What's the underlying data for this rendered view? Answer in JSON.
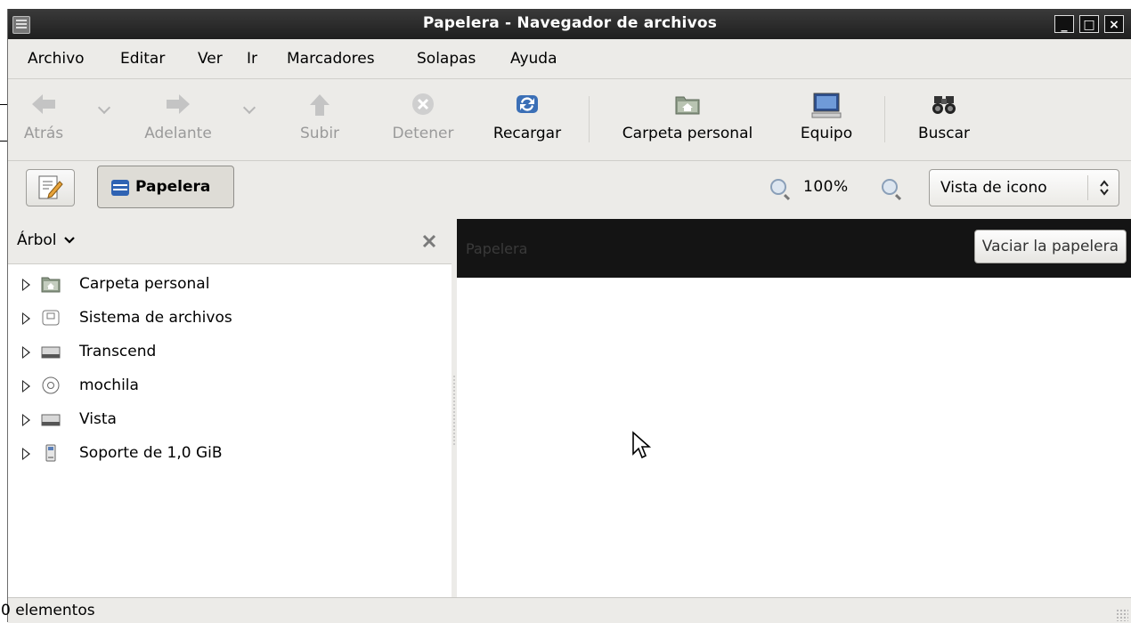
{
  "window": {
    "title": "Papelera - Navegador de archivos"
  },
  "menubar": {
    "items": [
      "Archivo",
      "Editar",
      "Ver",
      "Ir",
      "Marcadores",
      "Solapas",
      "Ayuda"
    ]
  },
  "toolbar": {
    "back": "Atrás",
    "forward": "Adelante",
    "up": "Subir",
    "stop": "Detener",
    "reload": "Recargar",
    "home": "Carpeta personal",
    "computer": "Equipo",
    "search": "Buscar"
  },
  "location": {
    "current": "Papelera",
    "zoom": "100%",
    "view_mode": "Vista de icono"
  },
  "sidebar": {
    "mode": "Árbol",
    "items": [
      {
        "label": "Carpeta personal",
        "icon": "home-folder-icon"
      },
      {
        "label": "Sistema de archivos",
        "icon": "filesystem-icon"
      },
      {
        "label": "Transcend",
        "icon": "drive-icon"
      },
      {
        "label": "mochila",
        "icon": "optical-disc-icon"
      },
      {
        "label": "Vista",
        "icon": "drive-icon"
      },
      {
        "label": "Soporte de 1,0 GiB",
        "icon": "usb-stick-icon"
      }
    ]
  },
  "content": {
    "location_label": "Papelera",
    "empty_trash": "Vaciar la papelera"
  },
  "status": {
    "text": "0 elementos"
  }
}
